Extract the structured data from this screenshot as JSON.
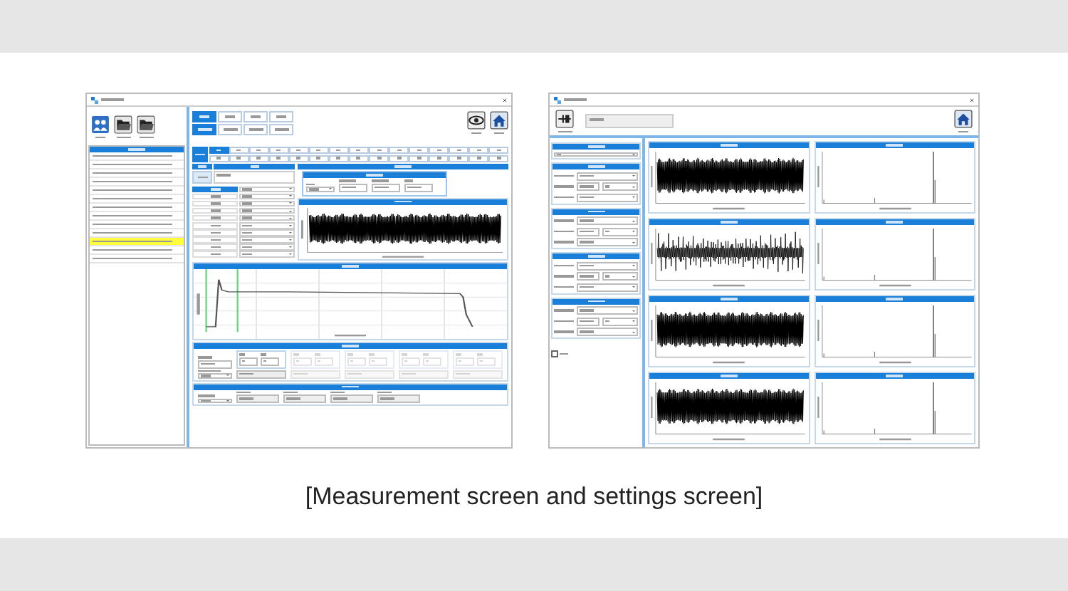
{
  "measurement_window": {
    "file_rows": [
      {
        "selected": false
      },
      {
        "selected": false
      },
      {
        "selected": false
      },
      {
        "selected": false
      },
      {
        "selected": false
      },
      {
        "selected": false
      },
      {
        "selected": false
      },
      {
        "selected": false
      },
      {
        "selected": false
      },
      {
        "selected": false
      },
      {
        "selected": true
      },
      {
        "selected": false
      },
      {
        "selected": false
      }
    ],
    "channel_tabs": [
      {
        "selected": true
      },
      {
        "selected": false
      },
      {
        "selected": false
      },
      {
        "selected": false
      }
    ],
    "direction_tabs": [
      {
        "selected": true
      },
      {
        "selected": false
      },
      {
        "selected": false
      },
      {
        "selected": false
      }
    ],
    "setting_items": [
      {
        "selected": true
      },
      {
        "selected": false
      },
      {
        "selected": false
      },
      {
        "selected": false
      },
      {
        "selected": false
      },
      {
        "selected": false
      },
      {
        "selected": false
      },
      {
        "selected": false
      },
      {
        "selected": false
      },
      {
        "selected": false
      },
      {
        "selected": false
      },
      {
        "selected": false
      },
      {
        "selected": false
      },
      {
        "selected": false
      },
      {
        "selected": false
      },
      {
        "selected": false
      },
      {
        "selected": false
      },
      {
        "selected": false
      },
      {
        "selected": false
      },
      {
        "selected": false
      },
      {
        "selected": false
      },
      {
        "selected": false
      },
      {
        "selected": false
      },
      {
        "selected": false
      },
      {
        "selected": false
      },
      {
        "selected": false
      },
      {
        "selected": false
      },
      {
        "selected": false
      },
      {
        "selected": false
      },
      {
        "selected": false
      }
    ],
    "steps": [
      {
        "selected": true
      },
      {
        "selected": false
      },
      {
        "selected": false
      },
      {
        "selected": false
      },
      {
        "selected": false
      },
      {
        "selected": false
      },
      {
        "selected": false
      },
      {
        "selected": false
      },
      {
        "selected": false
      },
      {
        "selected": false
      }
    ],
    "ranges": [
      {
        "disabled": false
      },
      {
        "disabled": true
      },
      {
        "disabled": true
      },
      {
        "disabled": true
      },
      {
        "disabled": true
      }
    ],
    "results": [
      {
        "disabled": false
      },
      {
        "disabled": true
      },
      {
        "disabled": true
      },
      {
        "disabled": true
      },
      {
        "disabled": true
      }
    ]
  },
  "settings_window": {
    "use_checkbox": {
      "checked": false
    },
    "graphs": [
      {
        "kind": "dense"
      },
      {
        "kind": "sparse"
      },
      {
        "kind": "dense"
      },
      {
        "kind": "dense"
      }
    ]
  },
  "caption": "[Measurement screen and settings screen]"
}
